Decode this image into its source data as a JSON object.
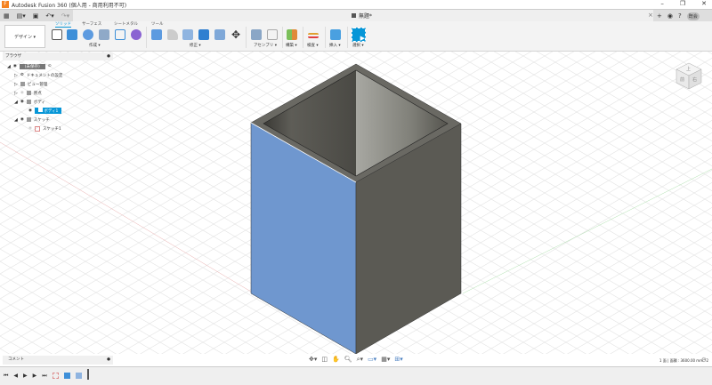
{
  "window": {
    "title": "Autodesk Fusion 360 (個人用 - 商用利用不可)",
    "minimize": "–",
    "restore": "❐",
    "close": "✕"
  },
  "quickbar": {
    "doc_title": "無題*",
    "tab_close": "×",
    "user": "既会"
  },
  "ribbon": {
    "workspace": "デザイン ▾",
    "tabs": [
      {
        "label": "ソリッド",
        "active": true
      },
      {
        "label": "サーフェス"
      },
      {
        "label": "シートメタル"
      },
      {
        "label": "ツール"
      }
    ],
    "groups": [
      "作成 ▾",
      "修正 ▾",
      "アセンブリ ▾",
      "構築 ▾",
      "検査 ▾",
      "挿入 ▾",
      "選択 ▾"
    ]
  },
  "browser": {
    "title": "ブラウザ",
    "items": [
      {
        "label": "(未保存)",
        "level": 0,
        "selected": false
      },
      {
        "label": "ドキュメントの設定",
        "level": 1
      },
      {
        "label": "ビュー管理",
        "level": 1
      },
      {
        "label": "原点",
        "level": 1
      },
      {
        "label": "ボディ",
        "level": 1
      },
      {
        "label": "ボディ1",
        "level": 2,
        "selected": true
      },
      {
        "label": "スケッチ",
        "level": 1
      },
      {
        "label": "スケッチ1",
        "level": 2
      }
    ]
  },
  "comments": {
    "label": "コメント"
  },
  "status": {
    "text": "1 面 | 面積 : 3600.00 mm^2"
  },
  "viewcube": {
    "labels": [
      "上",
      "前",
      "右"
    ]
  },
  "colors": {
    "accent": "#0696d7",
    "selected_face": "#6f97cf",
    "body": "#5b5a54"
  }
}
